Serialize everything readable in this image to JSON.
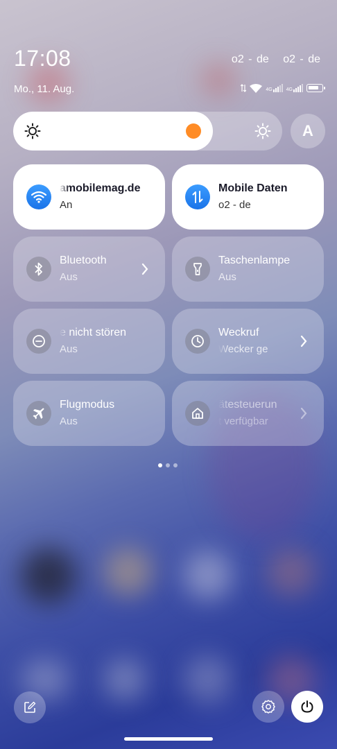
{
  "status": {
    "time": "17:08",
    "date": "Mo., 11. Aug.",
    "carrier1": "o2 - de",
    "carrier2": "o2 - de",
    "network1": "4G",
    "network2": "4G"
  },
  "brightness": {
    "level": 0.7,
    "auto_label": "A"
  },
  "tiles": [
    {
      "title": "amobilemag.de",
      "subtitle": "An",
      "icon": "wifi-icon",
      "active": true
    },
    {
      "title": "Mobile Daten",
      "subtitle": "o2 - de",
      "icon": "mobile-data-icon",
      "active": true
    },
    {
      "title": "Bluetooth",
      "subtitle": "Aus",
      "icon": "bluetooth-icon",
      "active": false
    },
    {
      "title": "Taschenlampe",
      "subtitle": "Aus",
      "icon": "flashlight-icon",
      "active": false
    },
    {
      "title": "e nicht stören",
      "subtitle": "Aus",
      "icon": "do-not-disturb-icon",
      "active": false
    },
    {
      "title": "Weckruf",
      "subtitle": "Wecker ge",
      "icon": "clock-icon",
      "active": false
    },
    {
      "title": "Flugmodus",
      "subtitle": "Aus",
      "icon": "airplane-icon",
      "active": false
    },
    {
      "title": "ätesteuerun",
      "subtitle": "t verfügbar",
      "icon": "home-icon",
      "active": false
    }
  ],
  "pager": {
    "pages": 3,
    "current": 1
  },
  "colors": {
    "accent": "#1a73e8",
    "slider_thumb": "#ff8c26"
  }
}
